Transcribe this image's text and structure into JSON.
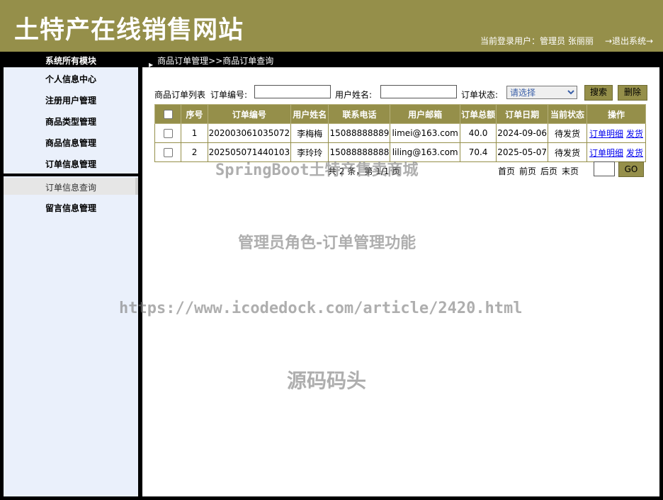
{
  "header": {
    "site_title": "土特产在线销售网站",
    "login_info": "当前登录用户：管理员 张丽丽",
    "logout": "→退出系统→"
  },
  "module_title": "系统所有模块",
  "breadcrumb": "商品订单管理>>商品订单查询",
  "sidebar": {
    "items": [
      {
        "label": "个人信息中心"
      },
      {
        "label": "注册用户管理"
      },
      {
        "label": "商品类型管理"
      },
      {
        "label": "商品信息管理"
      },
      {
        "label": "订单信息管理"
      }
    ],
    "sub_item": "订单信息查询",
    "last_item": "留言信息管理"
  },
  "search": {
    "list_label": "商品订单列表",
    "order_no_label": "订单编号:",
    "order_no_value": "",
    "user_name_label": "用户姓名:",
    "user_name_value": "",
    "status_label": "订单状态:",
    "status_selected": "请选择",
    "search_btn": "搜索",
    "delete_btn": "删除"
  },
  "table": {
    "headers": [
      "序号",
      "订单编号",
      "用户姓名",
      "联系电话",
      "用户邮箱",
      "订单总额",
      "订单日期",
      "当前状态",
      "操作"
    ],
    "rows": [
      {
        "idx": "1",
        "order_no": "202003061035072",
        "user": "李梅梅",
        "phone": "15088888889",
        "email": "limei@163.com",
        "total": "40.0",
        "date": "2024-09-06",
        "status": "待发货",
        "detail": "订单明细",
        "ship": "发货"
      },
      {
        "idx": "2",
        "order_no": "202505071440103",
        "user": "李玲玲",
        "phone": "15088888888",
        "email": "liling@163.com",
        "total": "70.4",
        "date": "2025-05-07",
        "status": "待发货",
        "detail": "订单明细",
        "ship": "发货"
      }
    ]
  },
  "pager": {
    "info": "共 2 条，第 1/1 页",
    "first": "首页",
    "prev": "前页",
    "next": "后页",
    "last": "末页",
    "go": "GO"
  },
  "watermarks": {
    "line1": "SpringBoot土特产售卖商城",
    "line2": "管理员角色-订单管理功能",
    "line3": "https://www.icodedock.com/article/2420.html",
    "line4": "源码码头"
  },
  "colors": {
    "olive": "#958f4a",
    "sidebar_bg": "#eaf0fb",
    "link": "#0000ee"
  }
}
